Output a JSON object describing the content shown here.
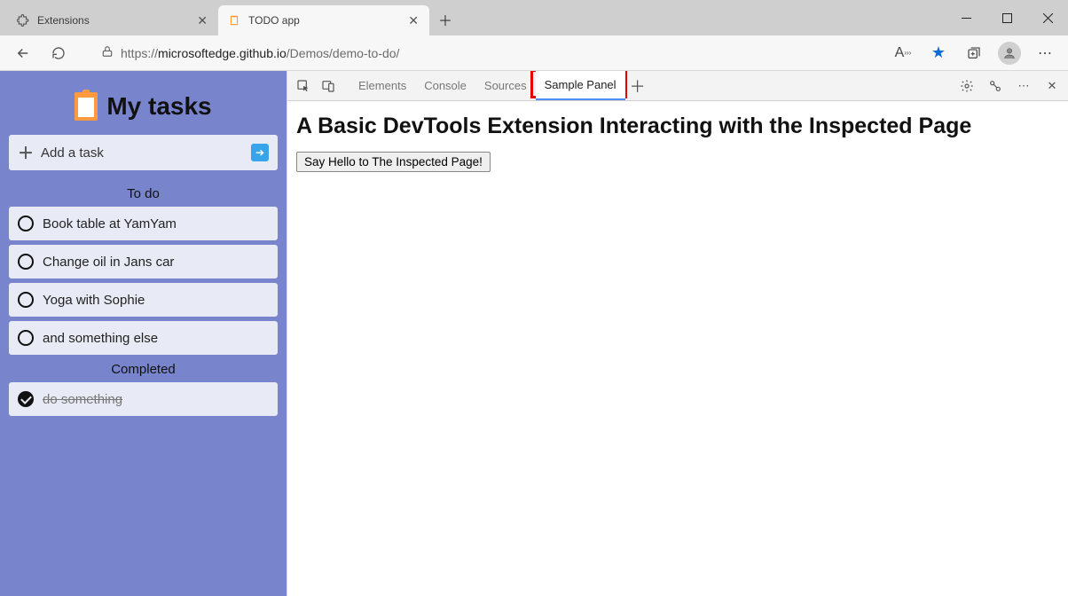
{
  "browser": {
    "tabs": [
      {
        "title": "Extensions",
        "active": false
      },
      {
        "title": "TODO app",
        "active": true
      }
    ],
    "url_dim_prefix": "https://",
    "url_dark": "microsoftedge.github.io",
    "url_dim_suffix": "/Demos/demo-to-do/"
  },
  "page": {
    "title": "My tasks",
    "add_task_label": "Add a task",
    "section_todo": "To do",
    "section_completed": "Completed",
    "todo_items": [
      "Book table at YamYam",
      "Change oil in Jans car",
      "Yoga with Sophie",
      "and something else"
    ],
    "completed_items": [
      "do something"
    ]
  },
  "devtools": {
    "tabs": [
      "Elements",
      "Console",
      "Sources",
      "Sample Panel"
    ],
    "active_tab_index": 3,
    "panel_title": "A Basic DevTools Extension Interacting with the Inspected Page",
    "panel_button_label": "Say Hello to The Inspected Page!"
  }
}
